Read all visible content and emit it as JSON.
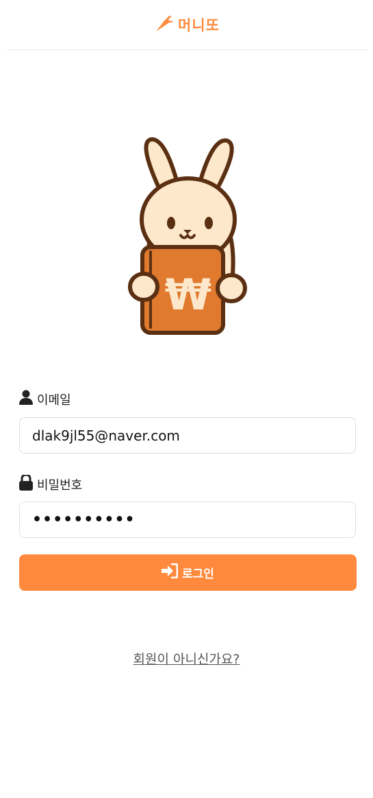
{
  "header": {
    "brand": "머니또",
    "logo_icon": "carrot-icon",
    "accent": "#ff8a3d"
  },
  "mascot": {
    "icon": "rabbit-holding-wallet-icon",
    "symbol": "₩"
  },
  "form": {
    "email_label": "이메일",
    "email_icon": "user-icon",
    "email_value": "dlak9jl55@naver.com",
    "password_label": "비밀번호",
    "password_icon": "lock-icon",
    "password_value": "••••••••••",
    "login_label": "로그인",
    "login_icon": "sign-in-icon"
  },
  "signup_link": "회원이 아니신가요?"
}
